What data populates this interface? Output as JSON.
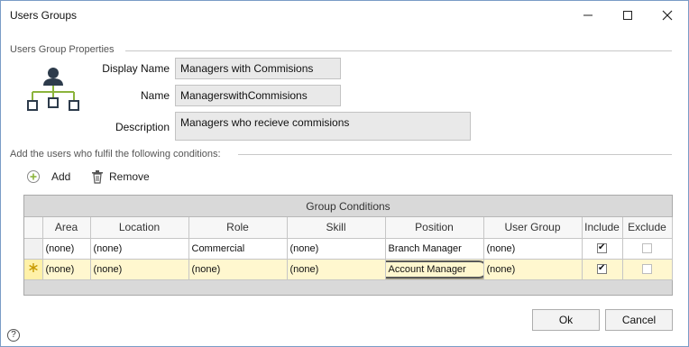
{
  "window": {
    "title": "Users Groups"
  },
  "properties": {
    "section_title": "Users Group Properties",
    "display_name_label": "Display Name",
    "display_name_value": "Managers with Commisions",
    "name_label": "Name",
    "name_value": "ManagerswithCommisions",
    "description_label": "Description",
    "description_value": "Managers who recieve commisions"
  },
  "conditions": {
    "section_title": "Add the users who fulfil the following conditions:",
    "add_label": "Add",
    "remove_label": "Remove",
    "grid_caption": "Group Conditions",
    "columns": [
      "Area",
      "Location",
      "Role",
      "Skill",
      "Position",
      "User Group",
      "Include",
      "Exclude"
    ],
    "rows": [
      {
        "area": "(none)",
        "location": "(none)",
        "role": "Commercial",
        "skill": "(none)",
        "position": "Branch Manager",
        "user_group": "(none)",
        "include": true,
        "exclude": false
      },
      {
        "area": "(none)",
        "location": "(none)",
        "role": "(none)",
        "skill": "(none)",
        "position": "Account Manager",
        "user_group": "(none)",
        "include": true,
        "exclude": false
      }
    ]
  },
  "footer": {
    "ok_label": "Ok",
    "cancel_label": "Cancel",
    "help_glyph": "?"
  },
  "colors": {
    "new_row_bg": "#fff7cf",
    "grid_header_bg": "#d9d9d9",
    "icon_green": "#8cb43c"
  }
}
